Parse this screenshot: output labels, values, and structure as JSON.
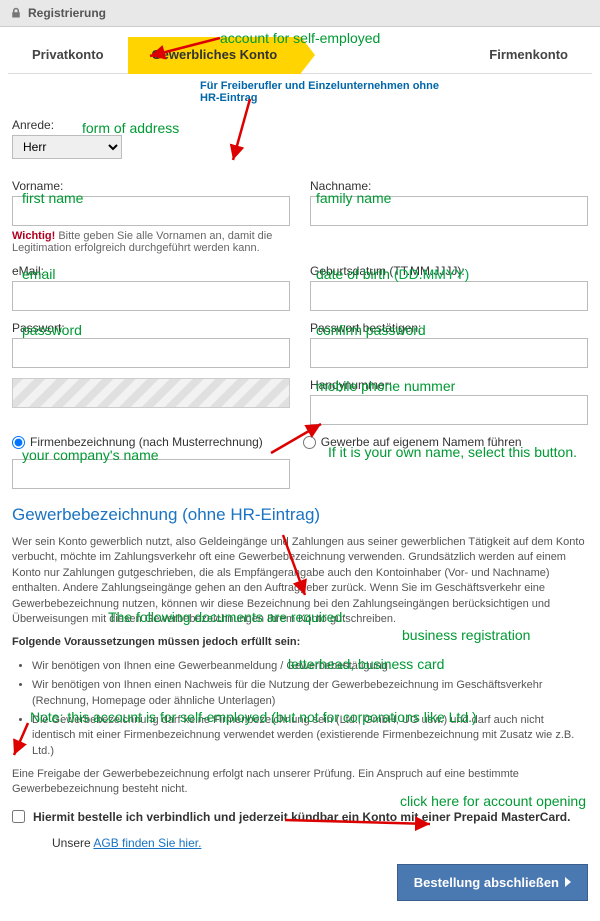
{
  "topbar": {
    "title": "Registrierung"
  },
  "tabs": {
    "private": "Privatkonto",
    "business": "Gewerbliches Konto",
    "company": "Firmenkonto",
    "sub_desc": "Für Freiberufler und Einzelunternehmen ohne HR-Eintrag"
  },
  "form": {
    "salutation_label": "Anrede:",
    "salutation_value": "Herr",
    "firstname_label": "Vorname:",
    "lastname_label": "Nachname:",
    "firstname_hint_prefix": "Wichtig!",
    "firstname_hint": " Bitte geben Sie alle Vornamen an, damit die Legitimation erfolgreich durchgeführt werden kann.",
    "email_label": "eMail:",
    "dob_label": "Geburtsdatum (TT.MM.JJJJ):",
    "password_label": "Passwort:",
    "password_confirm_label": "Passwort bestätigen:",
    "mobile_label": "Handynummer:",
    "radio1": "Firmenbezeichnung (nach Musterrechnung)",
    "radio2": "Gewerbe auf eigenem Namem führen"
  },
  "section": {
    "heading": "Gewerbebezeichnung (ohne HR-Eintrag)",
    "desc": "Wer sein Konto gewerblich nutzt, also Geldeingänge und Zahlungen aus seiner gewerblichen Tätigkeit auf dem Konto verbucht, möchte im Zahlungsverkehr oft eine Gewerbebezeichnung verwenden.\nGrundsätzlich werden auf einem Konto nur Zahlungen gutgeschrieben, die als Empfängerangabe auch den Kontoinhaber (Vor- und Nachname) enthalten. Andere Zahlungseingänge gehen an den Auftraggeber zurück. Wenn Sie im Geschäftsverkehr eine Gewerbebezeichnung nutzen, können wir diese Bezeichnung bei den Zahlungseingängen berücksichtigen und Überweisungen mit diesen Gewerbebezeichnungen Ihrem Konto gutschreiben.",
    "req_head": "Folgende Voraussetzungen müssen jedoch erfüllt sein:",
    "req1": "Wir benötigen von Ihnen eine Gewerbeanmeldung / Gewerbebestätigung",
    "req2": "Wir benötigen von Ihnen einen Nachweis für die Nutzung der Gewerbebezeichnung im Geschäftsverkehr (Rechnung, Homepage oder ähnliche Unterlagen)",
    "req3": "Die Gewerbebezeichnung darf keine Firmenbezeichnung sein (Ltd., GmbH, UG usw.) und darf auch nicht identisch mit einer Firmenbezeichnung verwendet werden (existierende Firmenbezeichnung mit Zusatz wie z.B. Ltd.)",
    "freigabe": "Eine Freigabe der Gewerbebezeichnung erfolgt nach unserer Prüfung. Ein Anspruch auf eine bestimmte Gewerbebezeichnung besteht nicht."
  },
  "checkbox": {
    "order_text": "Hiermit bestelle ich verbindlich und jederzeit kündbar ein Konto mit einer Prepaid MasterCard.",
    "agb_pre": "Unsere ",
    "agb_link": "AGB finden Sie hier."
  },
  "submit": {
    "label": "Bestellung abschließen"
  },
  "annotations": {
    "self_employed": "account for self-employed",
    "form_address": "form of address",
    "first_name": "first name",
    "family_name": "family name",
    "email": "email",
    "dob": "date of birth",
    "dob_fmt": "(DD.MMYY)",
    "password": "password",
    "confirm_pw": "confirm password",
    "mobile": "mobile phone nummer",
    "company": "your company's name",
    "own_name": "If it is your own name, select this button.",
    "req_docs": "The following documents are required:",
    "biz_reg": "business registration",
    "letterhead": "letterhead, business card",
    "note_corp": "Note: this account is for self-employed (but not for corporations like Ltd.)",
    "click_open": "click here for account opening"
  }
}
